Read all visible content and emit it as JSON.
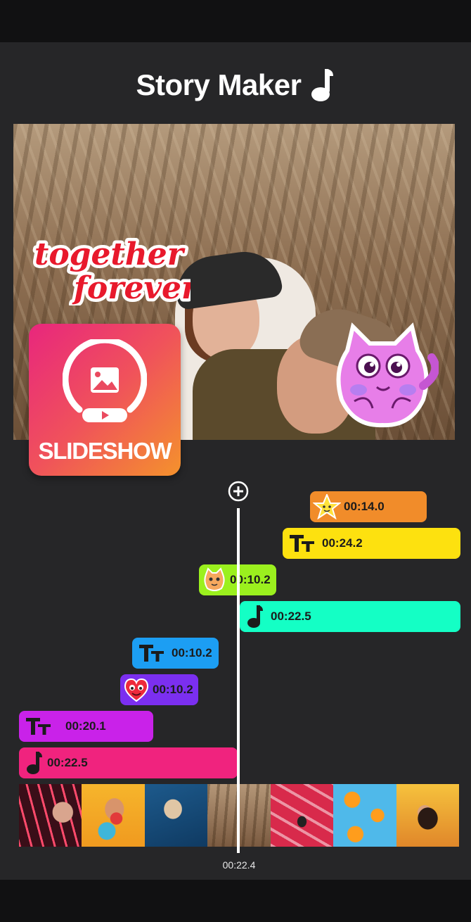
{
  "app": {
    "title": "Story Maker"
  },
  "preview": {
    "sticker_text_line1": "together",
    "sticker_text_line2": "forever",
    "badge_label": "SLIDESHOW"
  },
  "timeline": {
    "current_time": "00:22.4",
    "tracks": [
      {
        "kind": "sticker-star",
        "duration": "00:14.0",
        "color": "#f18c2a"
      },
      {
        "kind": "text",
        "duration": "00:24.2",
        "color": "#fde10f"
      },
      {
        "kind": "sticker-cat",
        "duration": "00:10.2",
        "color": "#9bf01e"
      },
      {
        "kind": "music",
        "duration": "00:22.5",
        "color": "#14ffc5"
      },
      {
        "kind": "text",
        "duration": "00:10.2",
        "color": "#1c9ef3"
      },
      {
        "kind": "sticker-heart",
        "duration": "00:10.2",
        "color": "#7b2ff0"
      },
      {
        "kind": "text",
        "duration": "00:20.1",
        "color": "#c922e9"
      },
      {
        "kind": "music",
        "duration": "00:22.5",
        "color": "#f0237e"
      }
    ],
    "thumbnails": [
      "neon-portrait",
      "beach-ball-woman",
      "blue-wall-jump",
      "cornfield-couple",
      "love-wall",
      "orange-slices",
      "sunset-portrait"
    ]
  }
}
